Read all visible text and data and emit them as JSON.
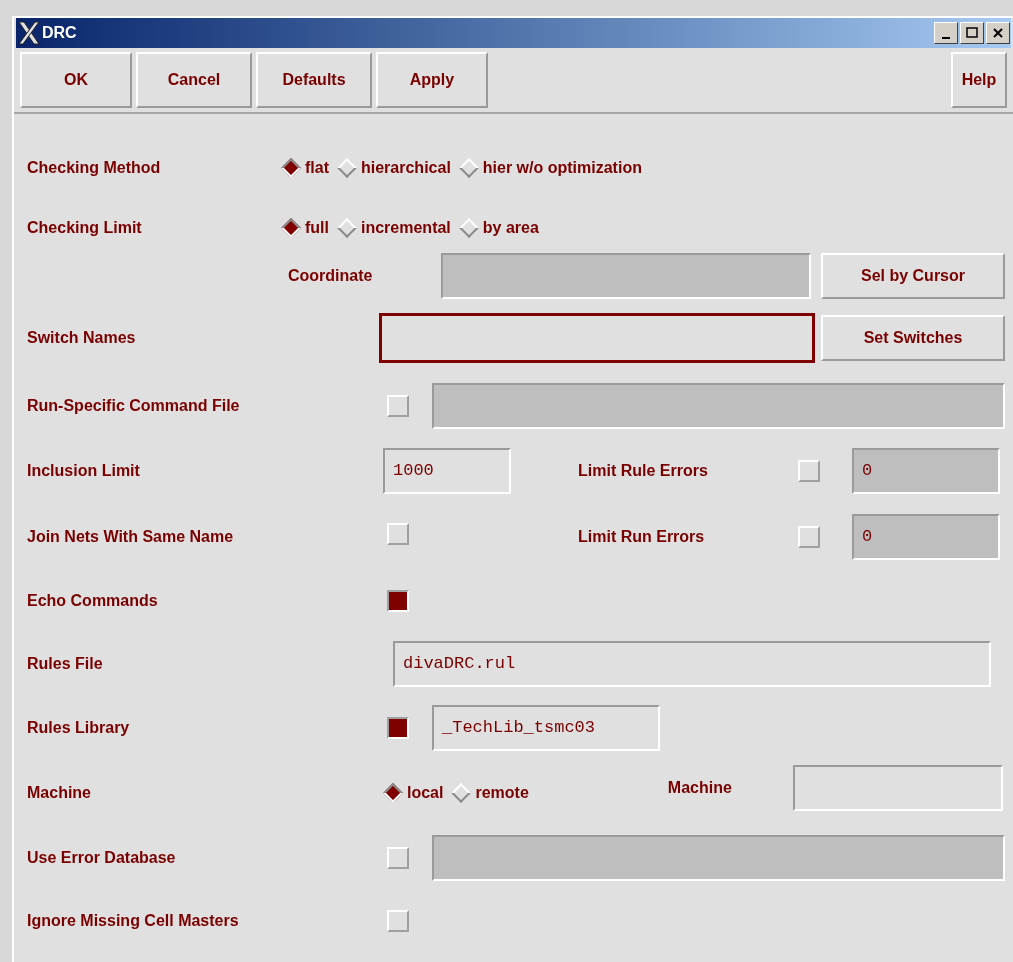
{
  "window": {
    "title": "DRC"
  },
  "buttons": [
    {
      "label": "OK"
    },
    {
      "label": "Cancel"
    },
    {
      "label": "Defaults"
    },
    {
      "label": "Apply"
    }
  ],
  "help_button": {
    "label": "Help"
  },
  "rows": [
    {
      "kind": "radio",
      "label": "Checking Method",
      "options": [
        {
          "label": "flat",
          "selected": true
        },
        {
          "label": "hierarchical",
          "selected": false
        },
        {
          "label": "hier w/o optimization",
          "selected": false
        }
      ]
    },
    {
      "kind": "radio",
      "label": "Checking Limit",
      "options": [
        {
          "label": "full",
          "selected": true
        },
        {
          "label": "incremental",
          "selected": false
        },
        {
          "label": "by area",
          "selected": false
        }
      ]
    },
    {
      "kind": "sub_field",
      "label": "Coordinate",
      "field": {
        "disabled": true
      },
      "button": "Sel by Cursor"
    },
    {
      "kind": "field_button",
      "label": "Switch Names",
      "field": {
        "focused": true
      },
      "button": "Set Switches"
    },
    {
      "kind": "check_field",
      "label": "Run-Specific Command File",
      "checked": false,
      "field": {
        "disabled": true
      }
    },
    {
      "kind": "field_limit",
      "label": "Inclusion Limit",
      "field": {
        "value": "1000"
      },
      "limit": {
        "label": "Limit Rule Errors",
        "checked": false,
        "field": {
          "value": "0",
          "disabled": true
        }
      }
    },
    {
      "kind": "check_limit",
      "label": "Join Nets With Same Name",
      "checked": false,
      "limit": {
        "label": "Limit Run Errors",
        "checked": false,
        "field": {
          "value": "0",
          "disabled": true
        }
      }
    },
    {
      "kind": "check",
      "label": "Echo Commands",
      "checked": true
    },
    {
      "kind": "field",
      "label": "Rules File",
      "field": {
        "value": "divaDRC.rul"
      }
    },
    {
      "kind": "check_field",
      "label": "Rules Library",
      "checked": true,
      "field": {
        "value": "_TechLib_tsmc03"
      }
    },
    {
      "kind": "radio_field",
      "label": "Machine",
      "options": [
        {
          "label": "local",
          "selected": true
        },
        {
          "label": "remote",
          "selected": false
        }
      ],
      "field_label": "Machine",
      "field": {}
    },
    {
      "kind": "check_field",
      "label": "Use Error Database",
      "checked": false,
      "field": {
        "disabled": true
      }
    },
    {
      "kind": "check",
      "label": "Ignore Missing Cell Masters",
      "checked": false
    }
  ]
}
